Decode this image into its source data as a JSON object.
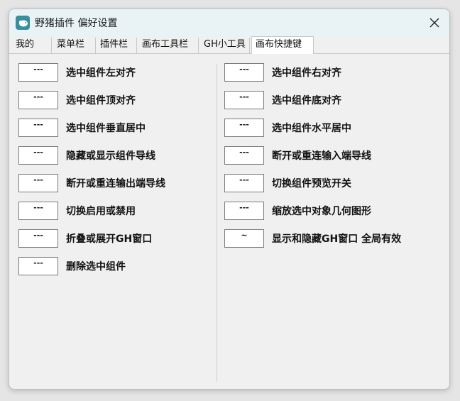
{
  "window": {
    "title": "野猪插件 偏好设置"
  },
  "tabs": [
    {
      "label": "我的",
      "active": false
    },
    {
      "label": "菜单栏",
      "active": false
    },
    {
      "label": "插件栏",
      "active": false
    },
    {
      "label": "画布工具栏",
      "active": false
    },
    {
      "label": "GH小工具",
      "active": false
    },
    {
      "label": "画布快捷键",
      "active": true
    }
  ],
  "shortcuts": {
    "left": [
      {
        "key": "---",
        "label": "选中组件左对齐"
      },
      {
        "key": "---",
        "label": "选中组件顶对齐"
      },
      {
        "key": "---",
        "label": "选中组件垂直居中"
      },
      {
        "key": "---",
        "label": "隐藏或显示组件导线"
      },
      {
        "key": "---",
        "label": "断开或重连输出端导线"
      },
      {
        "key": "---",
        "label": "切换启用或禁用"
      },
      {
        "key": "---",
        "label": "折叠或展开GH窗口"
      },
      {
        "key": "---",
        "label": "删除选中组件"
      }
    ],
    "right": [
      {
        "key": "---",
        "label": "选中组件右对齐"
      },
      {
        "key": "---",
        "label": "选中组件底对齐"
      },
      {
        "key": "---",
        "label": "选中组件水平居中"
      },
      {
        "key": "---",
        "label": "断开或重连输入端导线"
      },
      {
        "key": "---",
        "label": "切换组件预览开关"
      },
      {
        "key": "---",
        "label": "缩放选中对象几何图形"
      },
      {
        "key": "~",
        "label": "显示和隐藏GH窗口 全局有效"
      }
    ]
  },
  "colors": {
    "titlebar": "#e9f3f5",
    "window_bg": "#f0f0f0",
    "icon_bg": "#3a8e9c"
  }
}
